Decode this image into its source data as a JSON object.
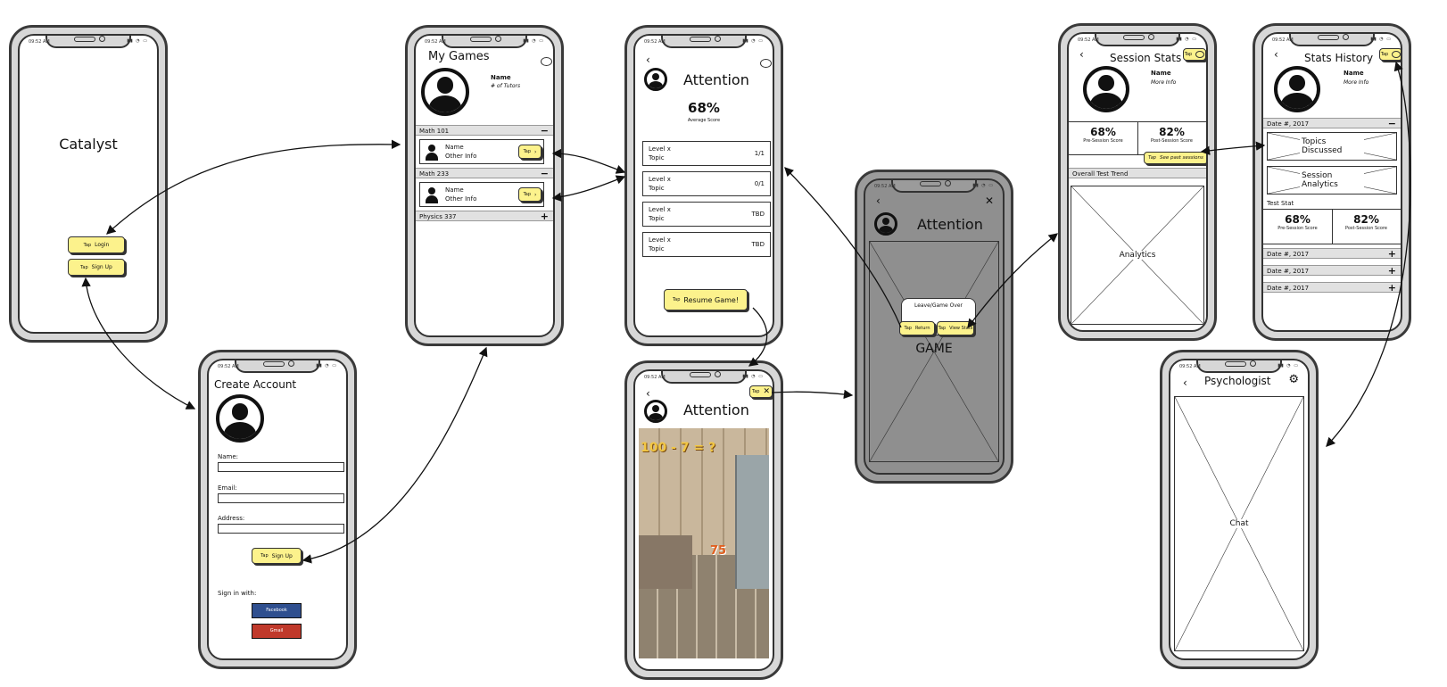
{
  "status_time": "09:52 AM",
  "catalyst": {
    "title": "Catalyst",
    "login": "Login",
    "signup": "Sign Up",
    "tap": "Tap"
  },
  "create_account": {
    "title": "Create Account",
    "name_label": "Name:",
    "email_label": "Email:",
    "address_label": "Address:",
    "signup": "Sign Up",
    "tap": "Tap",
    "sign_in_with": "Sign in with:",
    "facebook": "Facebook",
    "gmail": "Gmail",
    "colors": {
      "facebook": "#2f4f8f",
      "gmail": "#c0392b"
    }
  },
  "my_games": {
    "title": "My Games",
    "name": "Name",
    "sub": "# of Tutors",
    "sections": [
      {
        "label": "Math 101",
        "sign": "−"
      },
      {
        "label": "Math 233",
        "sign": "−"
      },
      {
        "label": "Physics 337",
        "sign": "+"
      }
    ],
    "rows": [
      {
        "name": "Name",
        "info": "Other Info",
        "tap": "Tap"
      },
      {
        "name": "Name",
        "info": "Other Info",
        "tap": "Tap"
      }
    ]
  },
  "attention_summary": {
    "title": "Attention",
    "percent": "68%",
    "avg": "Average Score",
    "levels": [
      {
        "level": "Level x",
        "topic": "Topic",
        "score": "1/1"
      },
      {
        "level": "Level x",
        "topic": "Topic",
        "score": "0/1"
      },
      {
        "level": "Level x",
        "topic": "Topic",
        "score": "TBD"
      },
      {
        "level": "Level x",
        "topic": "Topic",
        "score": "TBD"
      }
    ],
    "resume": "Resume Game!",
    "tap": "Tap"
  },
  "attention_game": {
    "title": "Attention",
    "tap": "Tap",
    "game_text": "100 - 7 = ?",
    "score": "75"
  },
  "game_over": {
    "title": "Attention",
    "dialog": "Leave/Game Over",
    "return": "Return",
    "view_stats": "View Stats",
    "tap": "Tap",
    "game": "GAME"
  },
  "session_stats": {
    "title": "Session Stats",
    "tap": "Tap",
    "name": "Name",
    "info": "More Info",
    "pre": {
      "value": "68%",
      "label": "Pre-Session Score"
    },
    "post": {
      "value": "82%",
      "label": "Post-Session Score"
    },
    "see_past": "See past sessions",
    "trend": "Overall Test Trend",
    "analytics": "Analytics"
  },
  "stats_history": {
    "title": "Stats History",
    "tap": "Tap",
    "name": "Name",
    "info": "More Info",
    "date_open": "Date #, 2017",
    "topics": "Topics Discussed",
    "analytics": "Session Analytics",
    "test_stat": "Test Stat",
    "pre": {
      "value": "68%",
      "label": "Pre-Session Score"
    },
    "post": {
      "value": "82%",
      "label": "Post-Session Score"
    },
    "dates": [
      "Date #, 2017",
      "Date #, 2017",
      "Date #, 2017"
    ]
  },
  "psychologist": {
    "title": "Psychologist",
    "chat": "Chat"
  },
  "colors": {
    "tap_yellow": "#fcf28c",
    "game_grey": "#8f8f8f"
  }
}
